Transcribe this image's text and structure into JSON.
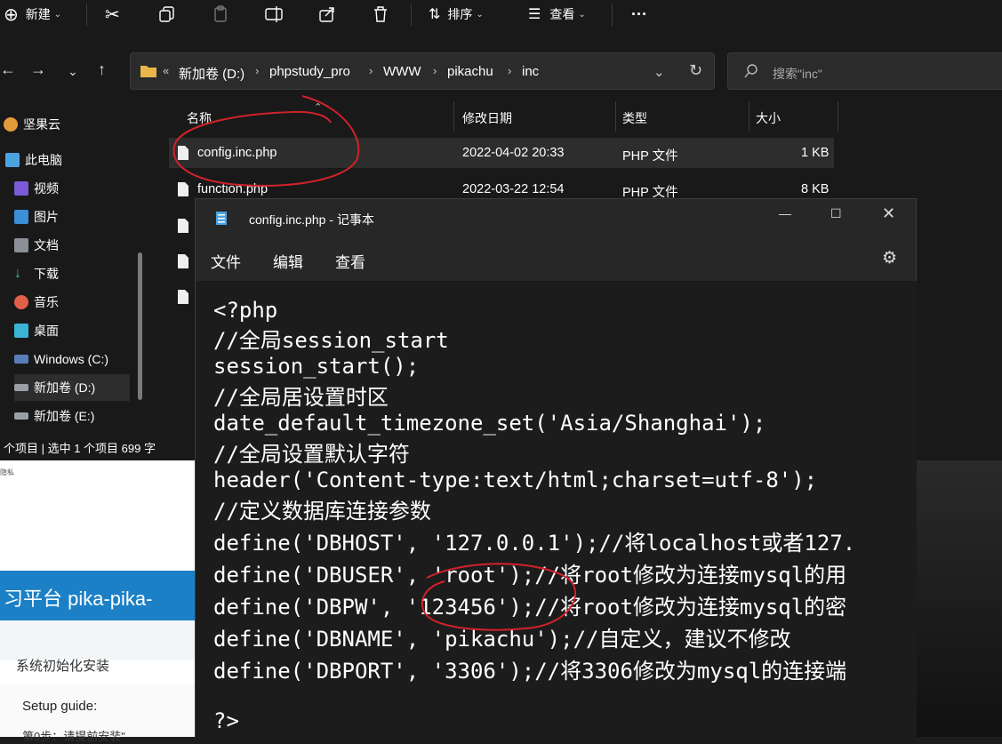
{
  "toolbar": {
    "new_label": "新建",
    "sort_label": "排序",
    "view_label": "查看",
    "more_label": "···"
  },
  "address": {
    "crumbs": [
      "新加卷 (D:)",
      "phpstudy_pro",
      "WWW",
      "pikachu",
      "inc"
    ],
    "search_placeholder": "搜索\"inc\""
  },
  "sidebar": {
    "items": [
      {
        "label": "坚果云",
        "icon": "jianguoyun-icon"
      },
      {
        "label": "此电脑",
        "icon": "this-pc-icon"
      },
      {
        "label": "视频",
        "icon": "videos-icon"
      },
      {
        "label": "图片",
        "icon": "pictures-icon"
      },
      {
        "label": "文档",
        "icon": "documents-icon"
      },
      {
        "label": "下载",
        "icon": "downloads-icon"
      },
      {
        "label": "音乐",
        "icon": "music-icon"
      },
      {
        "label": "桌面",
        "icon": "desktop-icon"
      },
      {
        "label": "Windows (C:)",
        "icon": "drive-c-icon"
      },
      {
        "label": "新加卷 (D:)",
        "icon": "drive-d-icon"
      },
      {
        "label": "新加卷 (E:)",
        "icon": "drive-e-icon"
      }
    ]
  },
  "files": {
    "headers": {
      "name": "名称",
      "date": "修改日期",
      "type": "类型",
      "size": "大小"
    },
    "rows": [
      {
        "name": "config.inc.php",
        "date": "2022-04-02 20:33",
        "type": "PHP 文件",
        "size": "1 KB"
      },
      {
        "name": "function.php",
        "date": "2022-03-22 12:54",
        "type": "PHP 文件",
        "size": "8 KB"
      }
    ]
  },
  "status": {
    "text": "个项目  |  选中 1 个项目  699 字"
  },
  "background_web": {
    "small_text": "隐私",
    "banner": "习平台 pika-pika-",
    "link": "系统初始化安装",
    "guide": "Setup guide:",
    "step": "第0步：请提前安装\""
  },
  "notepad": {
    "title": "config.inc.php - 记事本",
    "menu": [
      "文件",
      "编辑",
      "查看"
    ],
    "lines": [
      "<?php",
      "//全局session_start",
      "session_start();",
      "//全局居设置时区",
      "date_default_timezone_set('Asia/Shanghai');",
      "//全局设置默认字符",
      "header('Content-type:text/html;charset=utf-8');",
      "//定义数据库连接参数",
      "define('DBHOST', '127.0.0.1');//将localhost或者127.",
      "define('DBUSER', 'root');//将root修改为连接mysql的用",
      "define('DBPW', '123456');//将root修改为连接mysql的密",
      "define('DBNAME', 'pikachu');//自定义，建议不修改",
      "define('DBPORT', '3306');//将3306修改为mysql的连接端",
      "",
      "?>"
    ]
  },
  "colors": {
    "annotation": "#d0222a",
    "folder": "#e8b84a",
    "accent": "#1c80c6"
  }
}
